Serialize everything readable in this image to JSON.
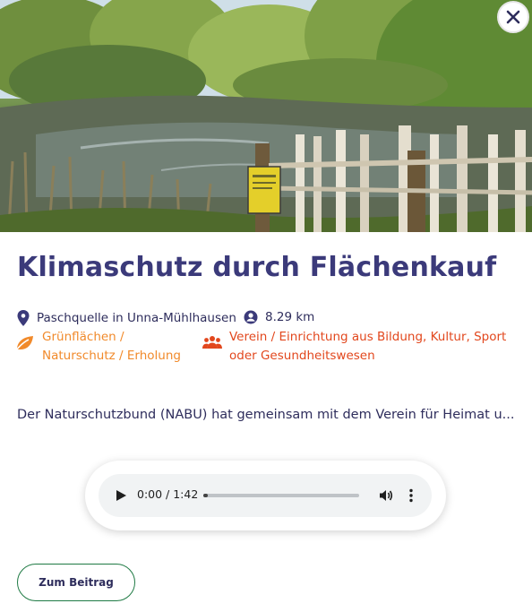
{
  "hero": {
    "image_alt": "Teich mit Holzzaun und Schild"
  },
  "close": {
    "icon": "close-icon",
    "label": "×"
  },
  "title": "Klimaschutz durch Flächenkauf",
  "meta": {
    "location": "Paschquelle in Unna-Mühlhausen",
    "distance": "8.29 km"
  },
  "categories": {
    "topic": "Grünflächen / Naturschutz / Erholung",
    "topic_line1": "Grünflächen /",
    "topic_line2": "Naturschutz / Erholung",
    "organization": "Verein / Einrichtung aus Bildung, Kultur, Sport oder Gesundheitswesen",
    "organization_line1": "Verein / Einrichtung aus Bildung, Kultur, Sport",
    "organization_line2": "oder Gesundheitswesen"
  },
  "description": "Der Naturschutzbund (NABU) hat gemeinsam mit dem Verein für Heimat u...",
  "audio": {
    "time": "0:00 / 1:42",
    "progress": 0.03
  },
  "cta": {
    "label": "Zum Beitrag"
  },
  "colors": {
    "title": "#3b3a7a",
    "text": "#2e2d5c",
    "topic": "#f18a2b",
    "organization": "#e2471d",
    "cta_border": "#1f7a44"
  }
}
